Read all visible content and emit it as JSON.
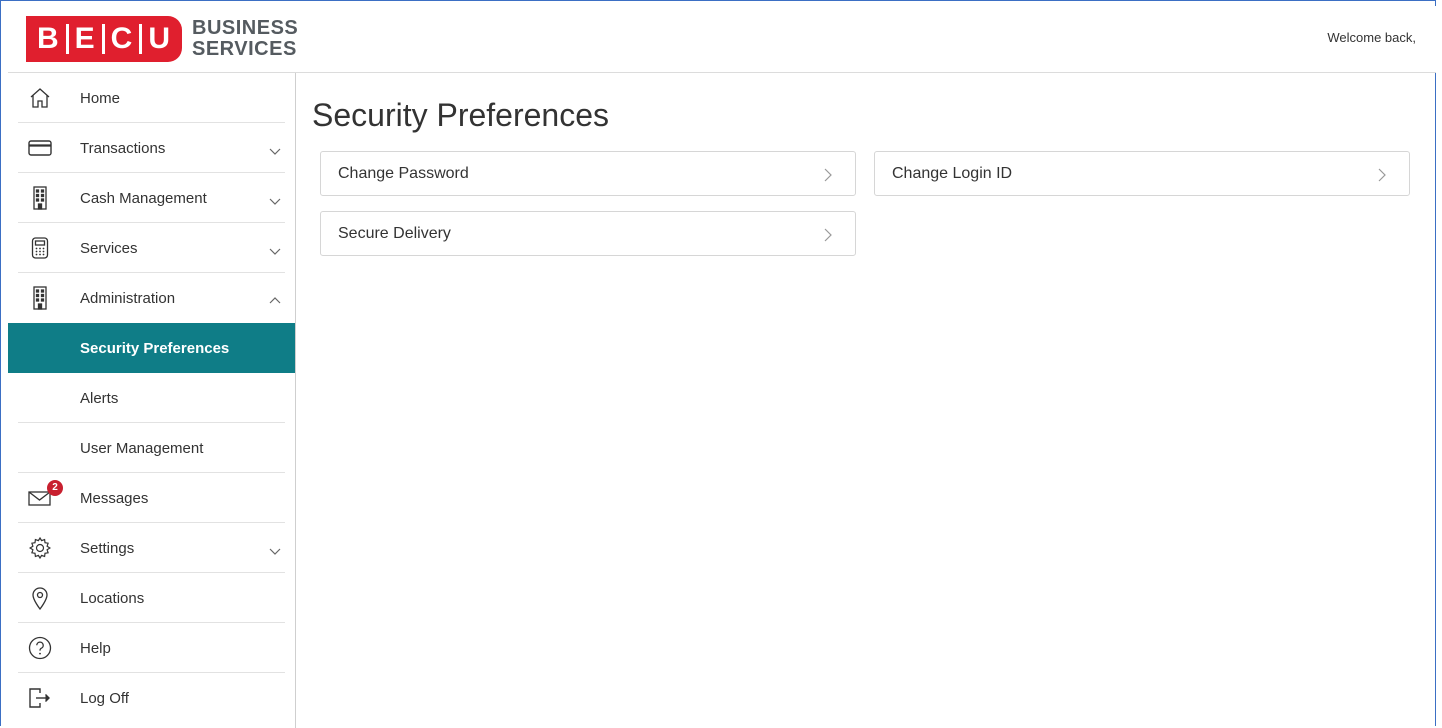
{
  "header": {
    "logo_letters": "B|E|C|U",
    "logo_line1": "BUSINESS",
    "logo_line2": "SERVICES",
    "welcome": "Welcome back,"
  },
  "sidebar": {
    "items": [
      {
        "label": "Home",
        "icon": "home-icon",
        "expandable": false
      },
      {
        "label": "Transactions",
        "icon": "card-icon",
        "expandable": true,
        "expanded": false
      },
      {
        "label": "Cash Management",
        "icon": "building-icon",
        "expandable": true,
        "expanded": false
      },
      {
        "label": "Services",
        "icon": "calculator-icon",
        "expandable": true,
        "expanded": false
      },
      {
        "label": "Administration",
        "icon": "building-icon",
        "expandable": true,
        "expanded": true
      },
      {
        "label": "Security Preferences",
        "sub": true,
        "active": true
      },
      {
        "label": "Alerts",
        "sub": true
      },
      {
        "label": "User Management",
        "sub": true
      },
      {
        "label": "Messages",
        "icon": "envelope-icon",
        "badge": "2"
      },
      {
        "label": "Settings",
        "icon": "gear-icon",
        "expandable": true,
        "expanded": false
      },
      {
        "label": "Locations",
        "icon": "location-pin-icon"
      },
      {
        "label": "Help",
        "icon": "help-icon"
      },
      {
        "label": "Log Off",
        "icon": "logoff-icon"
      }
    ]
  },
  "main": {
    "title": "Security Preferences",
    "cards": [
      {
        "label": "Change Password"
      },
      {
        "label": "Change Login ID"
      },
      {
        "label": "Secure Delivery"
      }
    ]
  },
  "colors": {
    "brand_red": "#e01f2e",
    "active_teal": "#0f7d87",
    "badge_red": "#c8202f",
    "frame_blue": "#3b6fc4"
  }
}
